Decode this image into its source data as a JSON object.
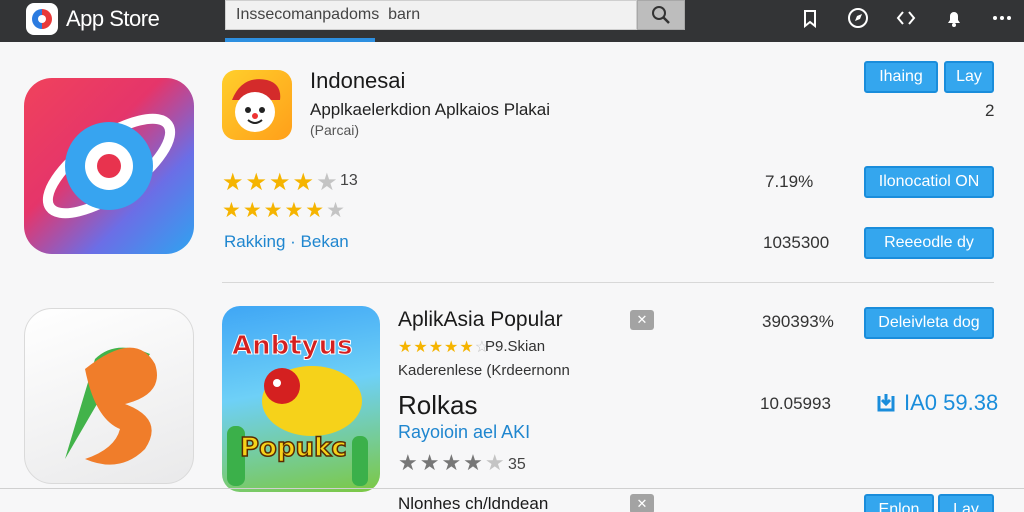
{
  "header": {
    "app_name": "App Store",
    "search_value": "Inssecomanpadoms  barn",
    "icons": [
      "search-icon",
      "bookmark-icon",
      "compass-icon",
      "code-icon",
      "notification-icon",
      "more-icon"
    ]
  },
  "featured": {
    "title": "Indonesai",
    "subtitle": "Applkaelerkdion Aplkaios Plakai",
    "tag": "(Parcai)",
    "rating_count": "13",
    "rating_primary": 4,
    "rating_secondary": 5,
    "link": "Rakking · Bekan",
    "side_number": "2",
    "percent": "7.19%",
    "big_number": "1035300",
    "buttons": {
      "primary": "Ihaing",
      "secondary": "Lay",
      "action_1": "Ilonocatiol ON",
      "action_2": "Reeeodle dy"
    }
  },
  "popular": {
    "title": "AplikAsia Popular",
    "rating_stars": 4.5,
    "rating_text": "P9.Skian",
    "subtitle": "Kaderenlese (Krdeernonn",
    "headline": "Rolkas",
    "link": "Rayoioin ael AKI",
    "rating_count": "35",
    "stars_value": 4,
    "percent": "390393%",
    "big_number": "10.05993",
    "price": "IA0 59.38",
    "icon_text_top": "Anbtyus",
    "icon_text_bottom": "Popukc",
    "button": "Deleivleta dog",
    "close": "✕"
  },
  "next_item": {
    "title": "Nlonhes ch/ldndean",
    "close": "✕",
    "buttons": {
      "primary": "Enlon",
      "secondary": "Lay"
    }
  },
  "colors": {
    "topbar": "#333436",
    "accent": "#34a6ee",
    "link": "#1f86cf",
    "star": "#f5b400"
  }
}
